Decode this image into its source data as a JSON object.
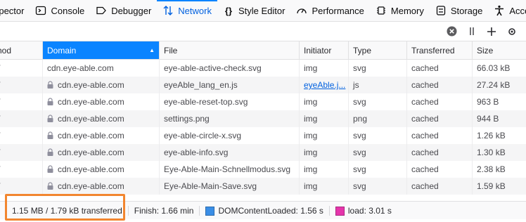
{
  "tabs": [
    {
      "label": "Inspector",
      "icon": "inspector-icon"
    },
    {
      "label": "Console",
      "icon": "console-icon"
    },
    {
      "label": "Debugger",
      "icon": "debugger-icon"
    },
    {
      "label": "Network",
      "icon": "network-icon",
      "selected": true
    },
    {
      "label": "Style Editor",
      "icon": "style-editor-icon"
    },
    {
      "label": "Performance",
      "icon": "performance-icon"
    },
    {
      "label": "Memory",
      "icon": "memory-icon"
    },
    {
      "label": "Storage",
      "icon": "storage-icon"
    },
    {
      "label": "Accessibility",
      "icon": "accessibility-icon"
    }
  ],
  "toolbar": {
    "clear_filter_icon": "clear-icon",
    "pause_icon": "pause-icon",
    "add_icon": "plus-icon",
    "settings_icon": "gear-icon"
  },
  "table": {
    "columns": [
      "Method",
      "Domain",
      "File",
      "Initiator",
      "Type",
      "Transferred",
      "Size"
    ],
    "sorted_column": "Domain",
    "rows": [
      {
        "method": "GET",
        "secure": false,
        "domain": "cdn.eye-able.com",
        "file": "eye-able-active-check.svg",
        "initiator": "img",
        "type": "svg",
        "transferred": "cached",
        "size": "66.03 kB"
      },
      {
        "method": "GET",
        "secure": true,
        "domain": "cdn.eye-able.com",
        "file": "eyeAble_lang_en.js",
        "initiator": "eyeAble.j...",
        "initiator_link": true,
        "type": "js",
        "transferred": "cached",
        "size": "27.24 kB"
      },
      {
        "method": "GET",
        "secure": true,
        "domain": "cdn.eye-able.com",
        "file": "eye-able-reset-top.svg",
        "initiator": "img",
        "type": "svg",
        "transferred": "cached",
        "size": "963 B"
      },
      {
        "method": "GET",
        "secure": true,
        "domain": "cdn.eye-able.com",
        "file": "settings.png",
        "initiator": "img",
        "type": "png",
        "transferred": "cached",
        "size": "944 B"
      },
      {
        "method": "GET",
        "secure": true,
        "domain": "cdn.eye-able.com",
        "file": "eye-able-circle-x.svg",
        "initiator": "img",
        "type": "svg",
        "transferred": "cached",
        "size": "1.26 kB"
      },
      {
        "method": "GET",
        "secure": true,
        "domain": "cdn.eye-able.com",
        "file": "eye-able-info.svg",
        "initiator": "img",
        "type": "svg",
        "transferred": "cached",
        "size": "1.30 kB"
      },
      {
        "method": "GET",
        "secure": true,
        "domain": "cdn.eye-able.com",
        "file": "Eye-Able-Main-Schnellmodus.svg",
        "initiator": "img",
        "type": "svg",
        "transferred": "cached",
        "size": "2.38 kB"
      },
      {
        "method": "GET",
        "secure": true,
        "domain": "cdn.eye-able.com",
        "file": "Eye-Able-Main-Save.svg",
        "initiator": "img",
        "type": "svg",
        "transferred": "cached",
        "size": "1.59 kB"
      }
    ]
  },
  "footer": {
    "transferred": "1.15 MB / 1.79 kB transferred",
    "finish": "Finish: 1.66 min",
    "dom_content_loaded": "DOMContentLoaded: 1.56 s",
    "load": "load: 3.01 s",
    "dcl_color": "#3a8ee6",
    "load_color": "#e535ab"
  },
  "colors": {
    "accent": "#0a84ff",
    "highlight_box": "#f2862f"
  }
}
